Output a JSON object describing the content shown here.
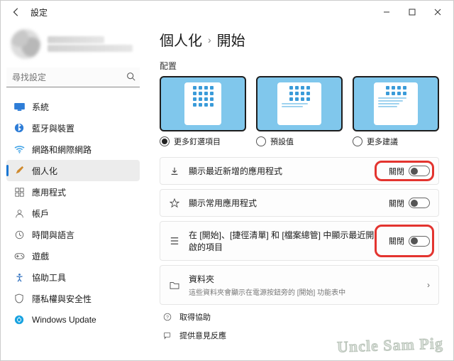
{
  "window": {
    "back_icon": "←",
    "title": "設定"
  },
  "user": {
    "name_redacted": true,
    "email_redacted": true
  },
  "search": {
    "placeholder": "尋找設定"
  },
  "sidebar": {
    "items": [
      {
        "icon": "system",
        "label": "系統",
        "color": "#2e7dd7"
      },
      {
        "icon": "bluetooth",
        "label": "藍牙與裝置",
        "color": "#2e7dd7"
      },
      {
        "icon": "wifi",
        "label": "網路和網際網路",
        "color": "#3aa0e6"
      },
      {
        "icon": "brush",
        "label": "個人化",
        "color": "#d08a2e",
        "active": true
      },
      {
        "icon": "apps",
        "label": "應用程式",
        "color": "#555"
      },
      {
        "icon": "account",
        "label": "帳戶",
        "color": "#555"
      },
      {
        "icon": "time",
        "label": "時間與語言",
        "color": "#555"
      },
      {
        "icon": "gaming",
        "label": "遊戲",
        "color": "#555"
      },
      {
        "icon": "access",
        "label": "協助工具",
        "color": "#3a78c2"
      },
      {
        "icon": "privacy",
        "label": "隱私權與安全性",
        "color": "#555"
      },
      {
        "icon": "update",
        "label": "Windows Update",
        "color": "#17a2e0"
      }
    ]
  },
  "breadcrumb": {
    "parent": "個人化",
    "current": "開始"
  },
  "layout": {
    "section_label": "配置",
    "options": [
      {
        "label": "更多釘選項目",
        "selected": true
      },
      {
        "label": "預設值",
        "selected": false
      },
      {
        "label": "更多建議",
        "selected": false
      }
    ]
  },
  "settings": [
    {
      "id": "recent-apps",
      "icon": "download",
      "title": "顯示最近新增的應用程式",
      "state_label": "關閉",
      "highlighted": true
    },
    {
      "id": "most-used",
      "icon": "star",
      "title": "顯示常用應用程式",
      "state_label": "關閉",
      "highlighted": false
    },
    {
      "id": "recent-items",
      "icon": "list",
      "title": "在 [開始]、[捷徑清單] 和 [檔案總管] 中顯示最近開啟的項目",
      "state_label": "關閉",
      "highlighted": true
    },
    {
      "id": "folders",
      "icon": "folder",
      "title": "資料夾",
      "subtitle": "這些資料夾會顯示在電源按鈕旁的 [開始] 功能表中",
      "nav": true
    }
  ],
  "footer": {
    "help": "取得協助",
    "feedback": "提供意見反應"
  },
  "watermark": "Uncle Sam Pig"
}
